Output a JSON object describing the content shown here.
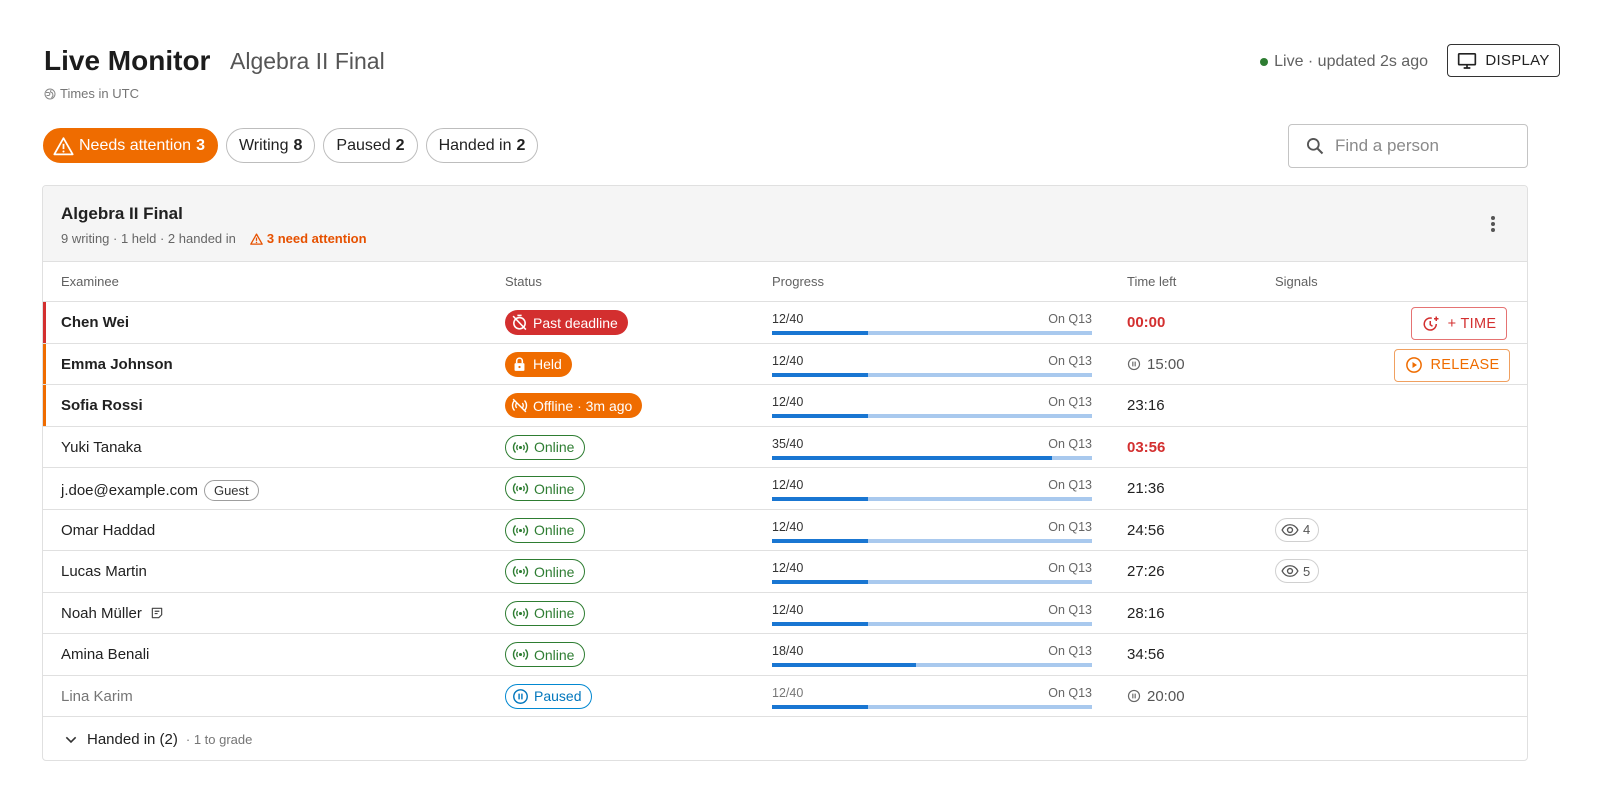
{
  "header": {
    "title": "Live Monitor",
    "subtitle": "Algebra II Final",
    "timezone": "Times in UTC",
    "live_status": "Live · updated 2s ago",
    "display_label": "DISPLAY"
  },
  "filters": [
    {
      "label": "Needs attention",
      "count": "3",
      "active": true
    },
    {
      "label": "Writing",
      "count": "8",
      "active": false
    },
    {
      "label": "Paused",
      "count": "2",
      "active": false
    },
    {
      "label": "Handed in",
      "count": "2",
      "active": false
    }
  ],
  "search": {
    "placeholder": "Find a person",
    "value": ""
  },
  "card": {
    "title": "Algebra II Final",
    "summary": "9 writing · 1 held · 2 handed in",
    "attention": "3 need attention"
  },
  "columns": {
    "examinee": "Examinee",
    "status": "Status",
    "progress": "Progress",
    "time_left": "Time left",
    "signals": "Signals"
  },
  "rows": [
    {
      "name": "Chen Wei",
      "status": "Past deadline",
      "progress": "12/40",
      "question": "On Q13",
      "fraction": 0.3,
      "time": "00:00"
    },
    {
      "name": "Emma Johnson",
      "status": "Held",
      "progress": "12/40",
      "question": "On Q13",
      "fraction": 0.3,
      "time": "15:00"
    },
    {
      "name": "Sofia Rossi",
      "status": "Offline · 3m ago",
      "progress": "12/40",
      "question": "On Q13",
      "fraction": 0.3,
      "time": "23:16"
    },
    {
      "name": "Yuki Tanaka",
      "status": "Online",
      "progress": "35/40",
      "question": "On Q13",
      "fraction": 0.875,
      "time": "03:56"
    },
    {
      "name": "j.doe@example.com",
      "tag": "Guest",
      "status": "Online",
      "progress": "12/40",
      "question": "On Q13",
      "fraction": 0.3,
      "time": "21:36"
    },
    {
      "name": "Omar Haddad",
      "status": "Online",
      "progress": "12/40",
      "question": "On Q13",
      "fraction": 0.3,
      "time": "24:56",
      "signal": "4"
    },
    {
      "name": "Lucas Martin",
      "status": "Online",
      "progress": "12/40",
      "question": "On Q13",
      "fraction": 0.3,
      "time": "27:26",
      "signal": "5"
    },
    {
      "name": "Noah Müller",
      "status": "Online",
      "progress": "12/40",
      "question": "On Q13",
      "fraction": 0.3,
      "time": "28:16"
    },
    {
      "name": "Amina Benali",
      "status": "Online",
      "progress": "18/40",
      "question": "On Q13",
      "fraction": 0.45,
      "time": "34:56"
    },
    {
      "name": "Lina Karim",
      "status": "Paused",
      "progress": "12/40",
      "question": "On Q13",
      "fraction": 0.3,
      "time": "20:00"
    }
  ],
  "actions": {
    "add_time": "+ TIME",
    "release": "RELEASE"
  },
  "footer": {
    "label": "Handed in (2)",
    "sub": "· 1 to grade"
  },
  "colors": {
    "accent": "#ef6c00",
    "danger": "#d32f2f",
    "online": "#2e7d32",
    "paused": "#0277bd",
    "progress": "#1976d2"
  }
}
